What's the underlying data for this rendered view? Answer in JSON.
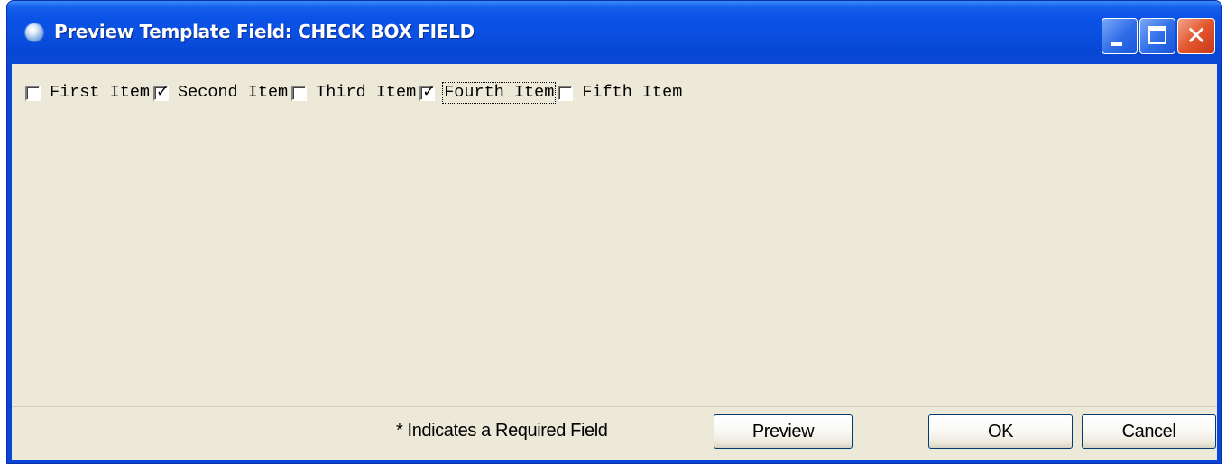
{
  "window": {
    "title": "Preview Template Field: CHECK BOX FIELD",
    "icon": "app-globe-icon",
    "controls": {
      "minimize": "minimize-icon",
      "maximize": "maximize-icon",
      "close": "close-icon"
    }
  },
  "checkboxes": [
    {
      "label": "First Item",
      "checked": false
    },
    {
      "label": "Second Item",
      "checked": true
    },
    {
      "label": "Third Item",
      "checked": false
    },
    {
      "label": "Fourth Item",
      "checked": true,
      "focused": true
    },
    {
      "label": "Fifth Item",
      "checked": false
    }
  ],
  "footer": {
    "required_note": "* Indicates a Required Field",
    "preview_label": "Preview",
    "ok_label": "OK",
    "cancel_label": "Cancel"
  },
  "colors": {
    "title_bar": "#0a4fe0",
    "client_bg": "#ece9d8",
    "close_button": "#e3562d"
  }
}
